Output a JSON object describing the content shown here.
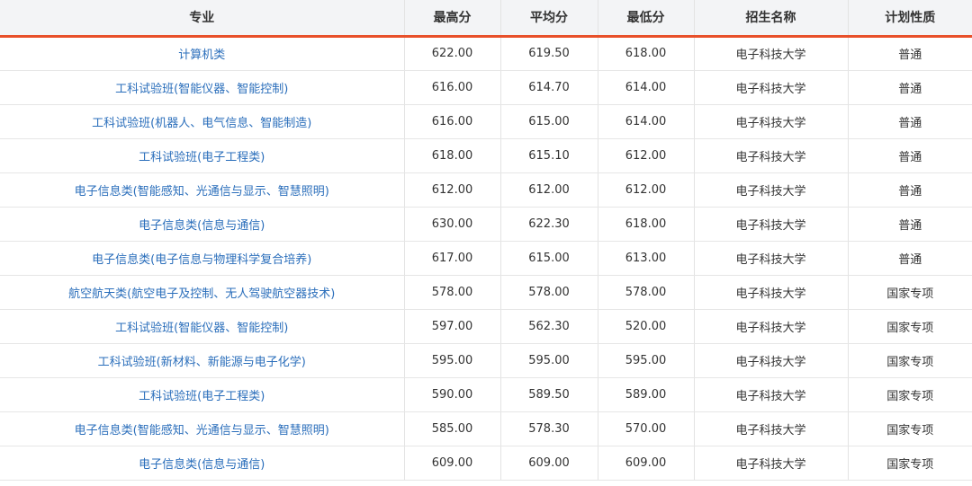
{
  "table": {
    "headers": [
      "专业",
      "最高分",
      "平均分",
      "最低分",
      "招生名称",
      "计划性质"
    ],
    "rows": [
      [
        "计算机类",
        "622.00",
        "619.50",
        "618.00",
        "电子科技大学",
        "普通"
      ],
      [
        "工科试验班(智能仪器、智能控制)",
        "616.00",
        "614.70",
        "614.00",
        "电子科技大学",
        "普通"
      ],
      [
        "工科试验班(机器人、电气信息、智能制造)",
        "616.00",
        "615.00",
        "614.00",
        "电子科技大学",
        "普通"
      ],
      [
        "工科试验班(电子工程类)",
        "618.00",
        "615.10",
        "612.00",
        "电子科技大学",
        "普通"
      ],
      [
        "电子信息类(智能感知、光通信与显示、智慧照明)",
        "612.00",
        "612.00",
        "612.00",
        "电子科技大学",
        "普通"
      ],
      [
        "电子信息类(信息与通信)",
        "630.00",
        "622.30",
        "618.00",
        "电子科技大学",
        "普通"
      ],
      [
        "电子信息类(电子信息与物理科学复合培养)",
        "617.00",
        "615.00",
        "613.00",
        "电子科技大学",
        "普通"
      ],
      [
        "航空航天类(航空电子及控制、无人驾驶航空器技术)",
        "578.00",
        "578.00",
        "578.00",
        "电子科技大学",
        "国家专项"
      ],
      [
        "工科试验班(智能仪器、智能控制)",
        "597.00",
        "562.30",
        "520.00",
        "电子科技大学",
        "国家专项"
      ],
      [
        "工科试验班(新材料、新能源与电子化学)",
        "595.00",
        "595.00",
        "595.00",
        "电子科技大学",
        "国家专项"
      ],
      [
        "工科试验班(电子工程类)",
        "590.00",
        "589.50",
        "589.00",
        "电子科技大学",
        "国家专项"
      ],
      [
        "电子信息类(智能感知、光通信与显示、智慧照明)",
        "585.00",
        "578.30",
        "570.00",
        "电子科技大学",
        "国家专项"
      ],
      [
        "电子信息类(信息与通信)",
        "609.00",
        "609.00",
        "609.00",
        "电子科技大学",
        "国家专项"
      ]
    ]
  },
  "colors": {
    "header_accent": "#e8502a",
    "link": "#2a6ebb"
  }
}
